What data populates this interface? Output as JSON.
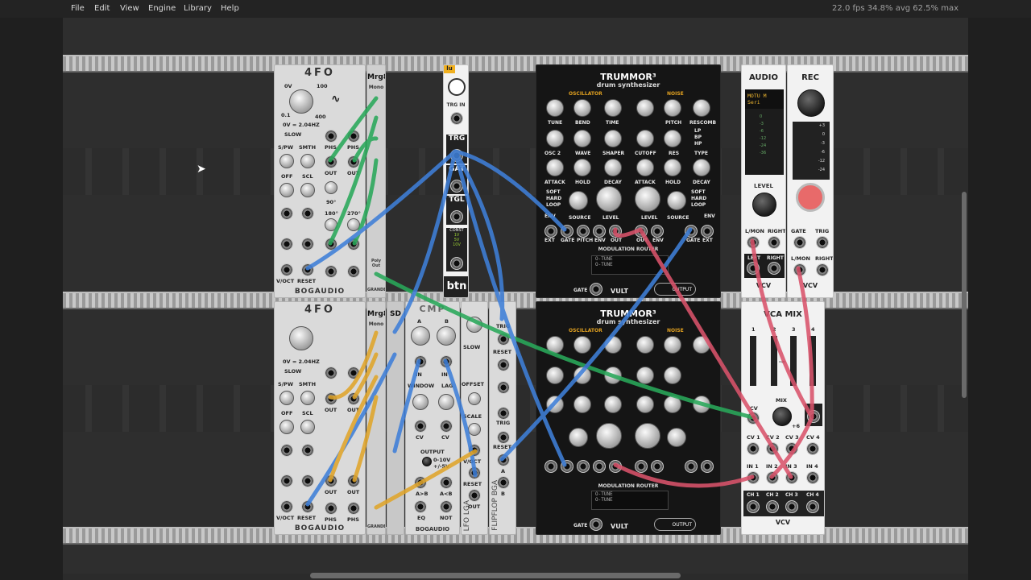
{
  "menu": [
    "File",
    "Edit",
    "View",
    "Engine",
    "Library",
    "Help"
  ],
  "perf": "22.0 fps  34.8% avg  62.5% max",
  "modules": {
    "fourfo": {
      "title": "4FO",
      "brand": "BOGAUDIO",
      "freq": "0V = 2.04HZ",
      "slow": "SLOW",
      "spw": "S/PW",
      "smth": "SMTH",
      "off": "OFF",
      "scl": "SCL",
      "phs": "PHS",
      "out": "OUT",
      "voct": "V/OCT",
      "reset": "RESET",
      "deg90": "90°",
      "deg180": "180°",
      "deg270": "270°",
      "z": "0V",
      "s1": "1",
      "s10": "10",
      "s100": "100",
      "s400": "400",
      "s200": "200",
      "s01": "0.1"
    },
    "mrg8": {
      "title": "Mrg8",
      "mono": "Mono",
      "polyout": "Poly Out",
      "brand": "GRANDE"
    },
    "btn": {
      "title": "btn",
      "trgin": "TRG IN",
      "trg": "TRG",
      "gat": "GAT",
      "tgl": "TGL",
      "const": "CONST",
      "v1": "1V",
      "v5": "5V",
      "v10": "10V",
      "logo": "lu"
    },
    "trummor": {
      "title": "TRUMMOR³",
      "subtitle": "drum synthesizer",
      "osc": "OSCILLATOR",
      "noise": "NOISE",
      "tune": "TUNE",
      "bend": "BEND",
      "time": "TIME",
      "pitch": "PITCH",
      "rescomb": "RESCOMB",
      "osc2": "OSC 2",
      "wave": "WAVE",
      "shaper": "SHAPER",
      "cutoff": "CUTOFF",
      "res": "RES",
      "type": "TYPE",
      "lp": "LP",
      "bp": "BP",
      "hp": "HP",
      "attack": "ATTACK",
      "hold": "HOLD",
      "decay": "DECAY",
      "soft": "SOFT",
      "hard": "HARD",
      "loop": "LOOP",
      "env": "ENV",
      "source": "SOURCE",
      "level": "LEVEL",
      "int": "INT",
      "ext": "EXT",
      "gate": "GATE",
      "out": "OUT",
      "modrouter": "MODULATION ROUTER",
      "otune": "O-TUNE",
      "output": "OUTPUT",
      "brand": "VULT"
    },
    "audio": {
      "title": "AUDIO",
      "device": "MOTU M Seri",
      "level": "LEVEL",
      "lmon": "L/MON",
      "right": "RIGHT",
      "left": "LEFT",
      "brand": "VCV",
      "db": [
        "0",
        "-3",
        "-6",
        "-12",
        "-24",
        "-36"
      ]
    },
    "rec": {
      "title": "REC",
      "gate": "GATE",
      "trig": "TRIG",
      "lmon": "L/MON",
      "right": "RIGHT",
      "brand": "VCV",
      "db": [
        "+3",
        "0",
        "-3",
        "-6",
        "-12",
        "-24"
      ]
    },
    "sd": {
      "title": "SD"
    },
    "cmp": {
      "title": "CMP",
      "brand": "BOGAUDIO",
      "a": "A",
      "b": "B",
      "in": "IN",
      "window": "WINDOW",
      "lag": "LAG",
      "cv": "CV",
      "output": "OUTPUT",
      "v10": "0-10V",
      "v5": "+/-5V",
      "agtb": "A>B",
      "altb": "A<B",
      "eq": "EQ",
      "not": "NOT"
    },
    "lfo": {
      "title": "LFO",
      "brand": "LGA",
      "slow": "SLOW",
      "offset": "OFFSET",
      "scale": "SCALE",
      "voct": "V/OCT",
      "reset": "RESET",
      "out": "OUT"
    },
    "flipflop": {
      "title": "FLIPFLOP",
      "brand": "BGA",
      "trig": "TRIG",
      "reset": "RESET",
      "a": "A",
      "b": "B"
    },
    "vcamix": {
      "title": "VCA MIX",
      "mix": "MIX",
      "ch": [
        "1",
        "2",
        "3",
        "4"
      ],
      "cv": [
        "CV 1",
        "CV 2",
        "CV 3",
        "CV 4"
      ],
      "in": [
        "IN 1",
        "IN 2",
        "IN 3",
        "IN 4"
      ],
      "chout": [
        "CH 1",
        "CH 2",
        "CH 3",
        "CH 4"
      ],
      "cvlbl": "CV",
      "mixlbl": "MIX",
      "brand": "VCV",
      "minf": "-∞",
      "p6": "+6"
    }
  },
  "colors": {
    "green": "#29a85a",
    "blue": "#3f7fd8",
    "orange": "#e0a52b",
    "red": "#d9536b",
    "teal": "#2aa0a0"
  }
}
